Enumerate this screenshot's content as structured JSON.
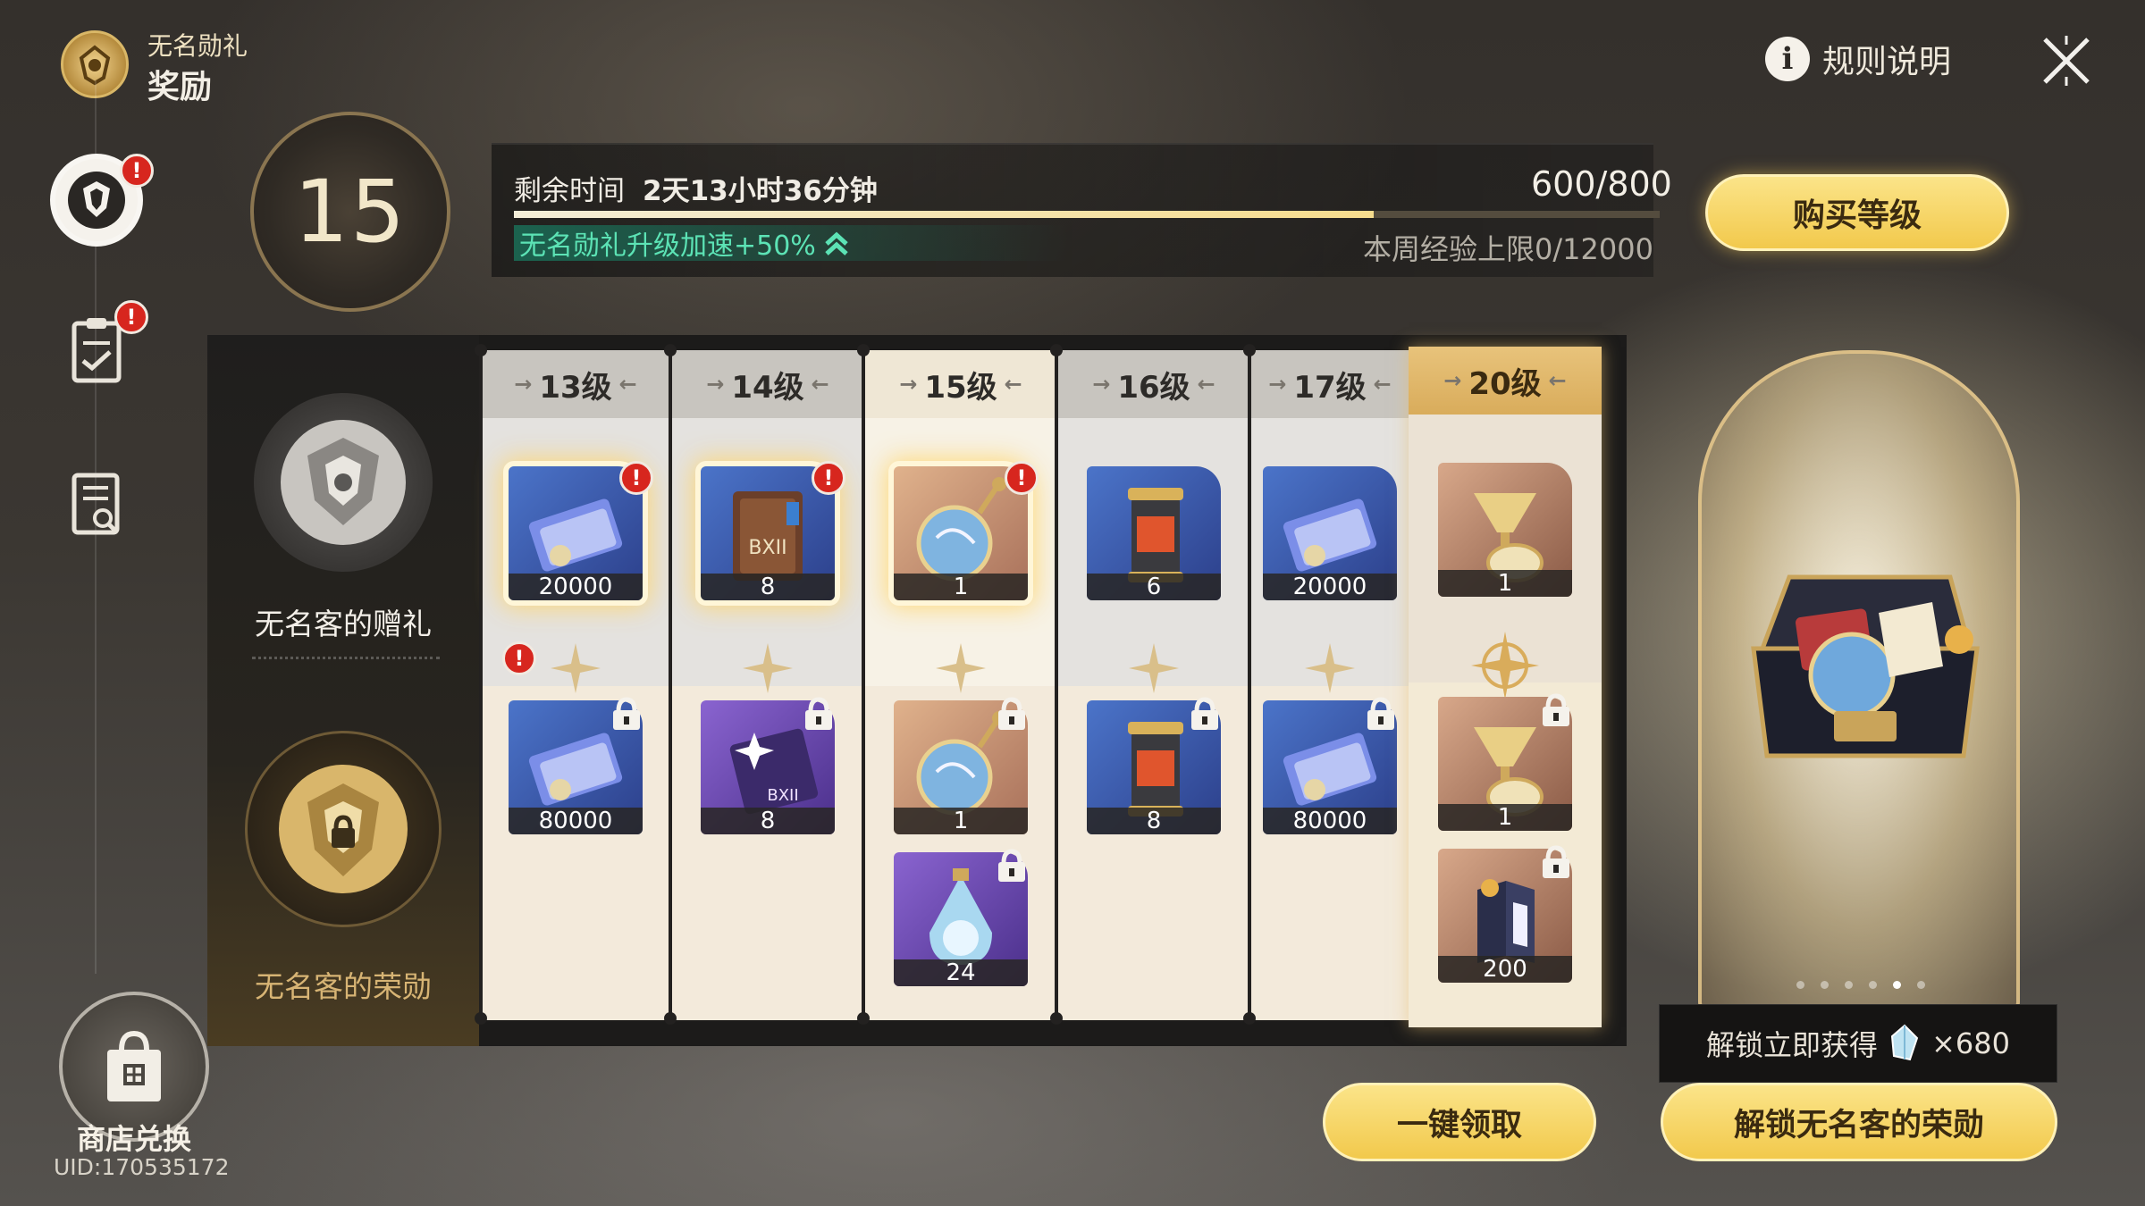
{
  "header": {
    "subtitle": "无名勋礼",
    "title": "奖励",
    "rules_label": "规则说明",
    "rules_icon": "info-icon",
    "close_icon": "close-icon"
  },
  "sidebar": {
    "items": [
      {
        "name": "pass-emblem-icon",
        "badge": "!"
      },
      {
        "name": "mission-clipboard-icon",
        "badge": "!"
      },
      {
        "name": "quest-search-icon",
        "badge": ""
      }
    ],
    "shop_label": "商店兑换",
    "uid": "UID:170535172"
  },
  "level": {
    "current": "15",
    "remaining_label": "剩余时间",
    "remaining_value": "2天13小时36分钟",
    "exp_text": "600/800",
    "exp_progress": 0.75,
    "boost_text": "无名勋礼升级加速+50%",
    "weekly_cap": "本周经验上限0/12000",
    "buy_label": "购买等级"
  },
  "tracks": {
    "free_name": "无名客的赠礼",
    "premium_name": "无名客的荣勋"
  },
  "columns": [
    {
      "label": "13级",
      "free": [
        {
          "icon": "ticket-card-icon",
          "qty": "20000",
          "claimable": true
        }
      ],
      "premium": [
        {
          "icon": "ticket-card-icon",
          "qty": "80000"
        }
      ]
    },
    {
      "label": "14级",
      "free": [
        {
          "icon": "book-icon",
          "qty": "8",
          "claimable": true
        }
      ],
      "premium": [
        {
          "icon": "sparkle-book-icon",
          "qty": "8"
        }
      ]
    },
    {
      "label": "15级",
      "free": [
        {
          "icon": "orb-pendant-icon",
          "qty": "1",
          "claimable": true
        }
      ],
      "premium": [
        {
          "icon": "orb-pendant-icon",
          "qty": "1"
        },
        {
          "icon": "crystal-flask-icon",
          "qty": "24"
        }
      ]
    },
    {
      "label": "16级",
      "free": [
        {
          "icon": "canister-icon",
          "qty": "6"
        }
      ],
      "premium": [
        {
          "icon": "canister-icon",
          "qty": "8"
        }
      ]
    },
    {
      "label": "17级",
      "free": [
        {
          "icon": "ticket-card-icon",
          "qty": "20000"
        }
      ],
      "premium": [
        {
          "icon": "ticket-card-icon",
          "qty": "80000"
        }
      ]
    },
    {
      "label": "20级",
      "free": [
        {
          "icon": "goblet-icon",
          "qty": "1"
        }
      ],
      "premium": [
        {
          "icon": "goblet-icon",
          "qty": "1"
        },
        {
          "icon": "relic-book-icon",
          "qty": "200"
        }
      ]
    }
  ],
  "chest": {
    "unlock_tip_prefix": "解锁立即获得",
    "unlock_tip_qty": "×680",
    "unlock_button": "解锁无名客的荣勋",
    "pages": 6,
    "active_page": 5
  },
  "claim_all_label": "一键领取",
  "colors": {
    "gold_button": "#f2c94c",
    "badge_red": "#d7261e",
    "boost_green": "#5ce3b5"
  }
}
